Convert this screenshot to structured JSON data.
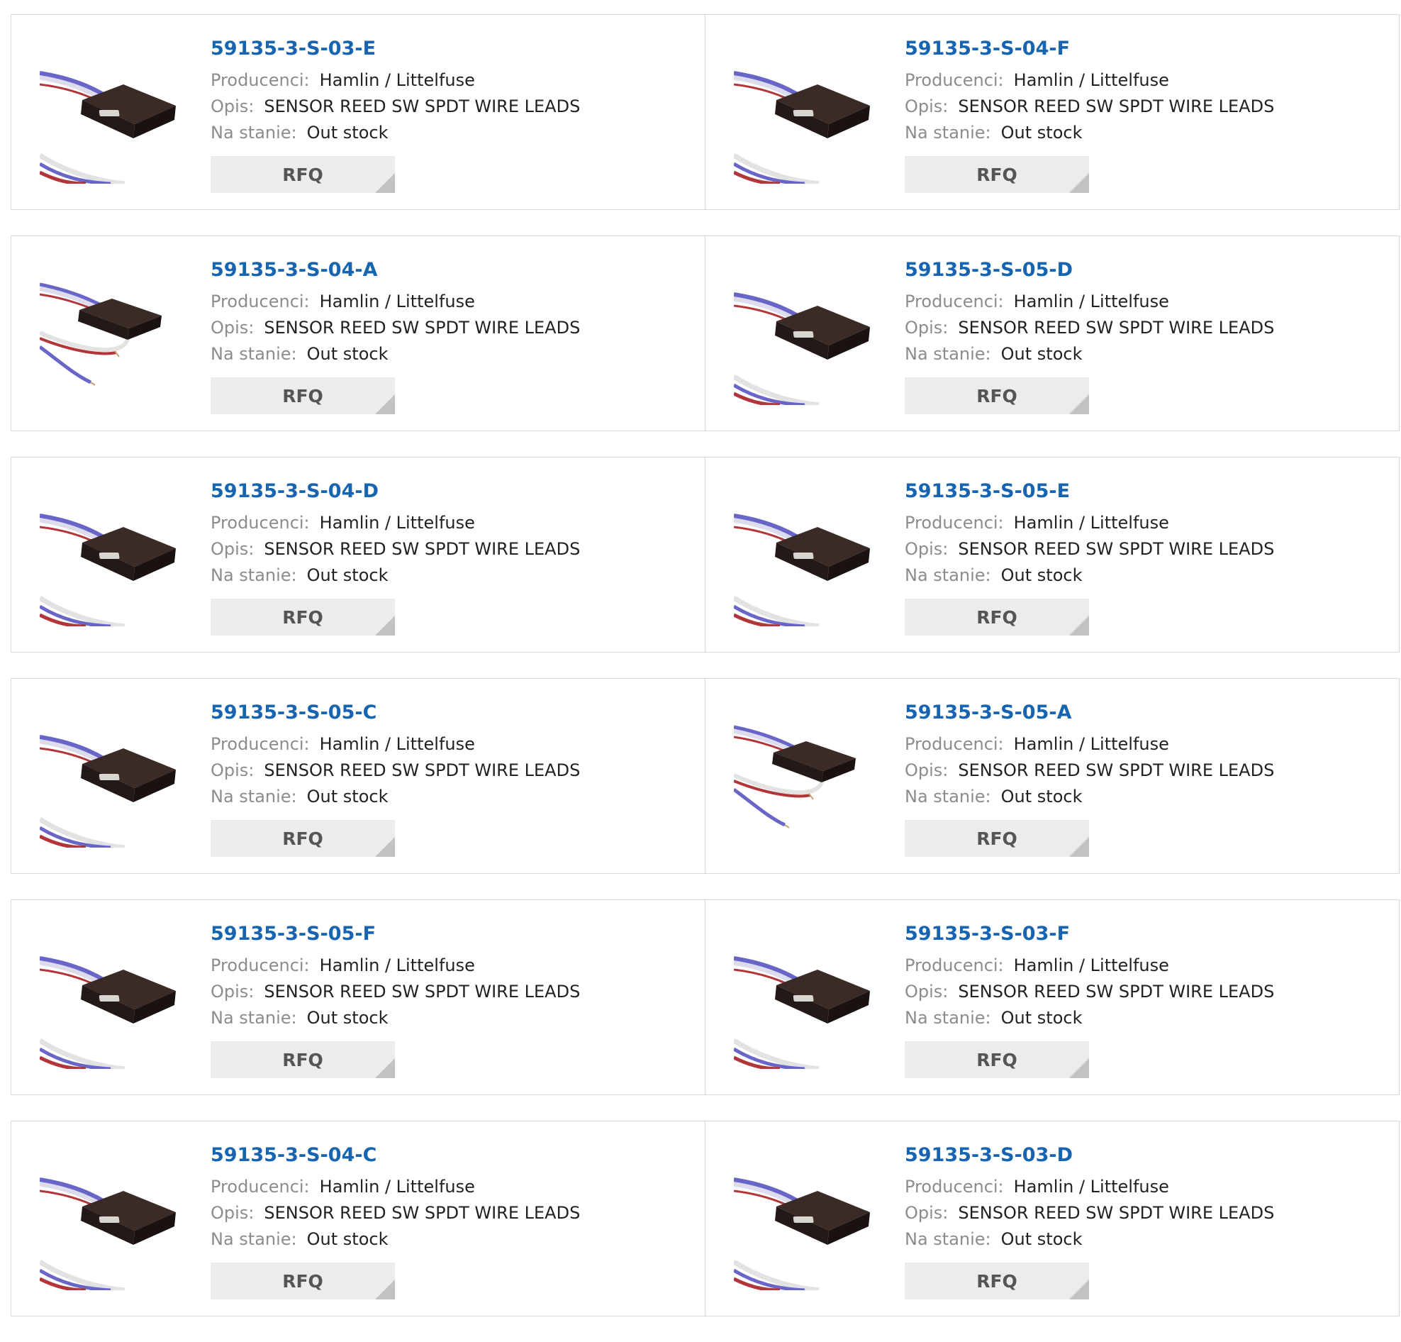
{
  "labels": {
    "manufacturer": "Producenci:",
    "description": "Opis:",
    "stock": "Na stanie:",
    "rfq": "RFQ"
  },
  "colors": {
    "part_link": "#1764b0",
    "label_gray": "#8c8c8c",
    "rfq_bg": "#ececec",
    "wire_blue": "#6a66c8",
    "wire_red": "#b2353a"
  },
  "products": [
    {
      "part": "59135-3-S-03-E",
      "manufacturer": "Hamlin / Littelfuse",
      "description": "SENSOR REED SW SPDT WIRE LEADS",
      "stock": "Out stock",
      "image": "reed-sensor-icon"
    },
    {
      "part": "59135-3-S-04-F",
      "manufacturer": "Hamlin / Littelfuse",
      "description": "SENSOR REED SW SPDT WIRE LEADS",
      "stock": "Out stock",
      "image": "reed-sensor-icon"
    },
    {
      "part": "59135-3-S-04-A",
      "manufacturer": "Hamlin / Littelfuse",
      "description": "SENSOR REED SW SPDT WIRE LEADS",
      "stock": "Out stock",
      "image": "reed-sensor-stripped-icon"
    },
    {
      "part": "59135-3-S-05-D",
      "manufacturer": "Hamlin / Littelfuse",
      "description": "SENSOR REED SW SPDT WIRE LEADS",
      "stock": "Out stock",
      "image": "reed-sensor-icon"
    },
    {
      "part": "59135-3-S-04-D",
      "manufacturer": "Hamlin / Littelfuse",
      "description": "SENSOR REED SW SPDT WIRE LEADS",
      "stock": "Out stock",
      "image": "reed-sensor-icon"
    },
    {
      "part": "59135-3-S-05-E",
      "manufacturer": "Hamlin / Littelfuse",
      "description": "SENSOR REED SW SPDT WIRE LEADS",
      "stock": "Out stock",
      "image": "reed-sensor-icon"
    },
    {
      "part": "59135-3-S-05-C",
      "manufacturer": "Hamlin / Littelfuse",
      "description": "SENSOR REED SW SPDT WIRE LEADS",
      "stock": "Out stock",
      "image": "reed-sensor-icon"
    },
    {
      "part": "59135-3-S-05-A",
      "manufacturer": "Hamlin / Littelfuse",
      "description": "SENSOR REED SW SPDT WIRE LEADS",
      "stock": "Out stock",
      "image": "reed-sensor-stripped-icon"
    },
    {
      "part": "59135-3-S-05-F",
      "manufacturer": "Hamlin / Littelfuse",
      "description": "SENSOR REED SW SPDT WIRE LEADS",
      "stock": "Out stock",
      "image": "reed-sensor-icon"
    },
    {
      "part": "59135-3-S-03-F",
      "manufacturer": "Hamlin / Littelfuse",
      "description": "SENSOR REED SW SPDT WIRE LEADS",
      "stock": "Out stock",
      "image": "reed-sensor-icon"
    },
    {
      "part": "59135-3-S-04-C",
      "manufacturer": "Hamlin / Littelfuse",
      "description": "SENSOR REED SW SPDT WIRE LEADS",
      "stock": "Out stock",
      "image": "reed-sensor-icon"
    },
    {
      "part": "59135-3-S-03-D",
      "manufacturer": "Hamlin / Littelfuse",
      "description": "SENSOR REED SW SPDT WIRE LEADS",
      "stock": "Out stock",
      "image": "reed-sensor-icon"
    }
  ]
}
